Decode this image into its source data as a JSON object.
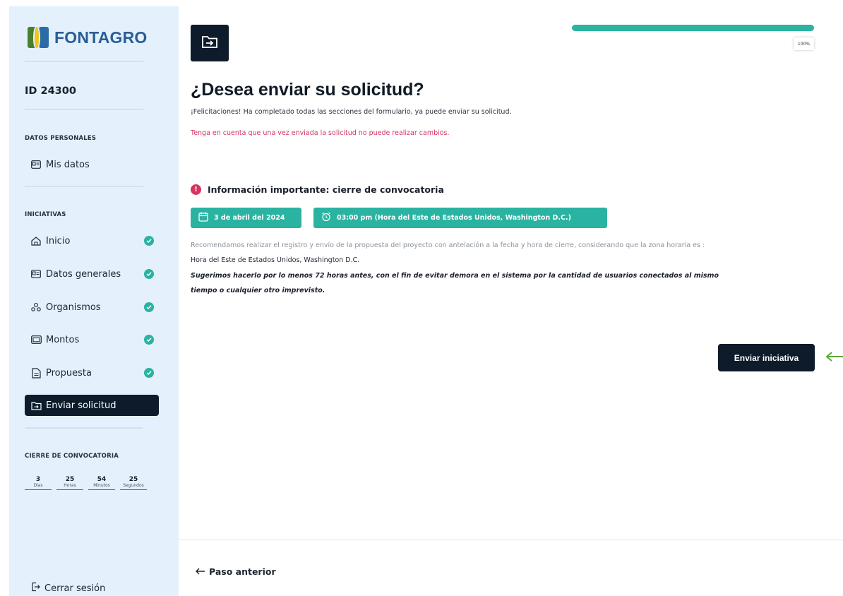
{
  "sidebar": {
    "brand": "FONTAGRO",
    "id_label": "ID 24300",
    "sections": {
      "personal": "DATOS PERSONALES",
      "initiatives": "INICIATIVAS",
      "deadline": "CIERRE DE CONVOCATORIA"
    },
    "personal_items": [
      {
        "label": "Mis datos",
        "icon": "id-card-icon"
      }
    ],
    "items": [
      {
        "label": "Inicio",
        "icon": "home-icon",
        "completed": true
      },
      {
        "label": "Datos generales",
        "icon": "id-card-icon",
        "completed": true
      },
      {
        "label": "Organismos",
        "icon": "organization-icon",
        "completed": true
      },
      {
        "label": "Montos",
        "icon": "money-icon",
        "completed": true
      },
      {
        "label": "Propuesta",
        "icon": "document-icon",
        "completed": true
      },
      {
        "label": "Enviar solicitud",
        "icon": "send-folder-icon",
        "active": true
      }
    ],
    "countdown": [
      {
        "value": "3",
        "unit": "Días"
      },
      {
        "value": "25",
        "unit": "Horas"
      },
      {
        "value": "54",
        "unit": "Minutos"
      },
      {
        "value": "25",
        "unit": "Segundos"
      }
    ],
    "logout": "Cerrar sesión"
  },
  "progress": {
    "percent": 100,
    "label": "100%"
  },
  "main": {
    "title": "¿Desea enviar su solicitud?",
    "congrats": "¡Felicitaciones! Ha completado todas las secciones del formulario, ya puede enviar su solicitud.",
    "warning": "Tenga en cuenta que una vez enviada la solicitud no puede realizar cambios.",
    "info_heading": "Información importante: cierre de convocatoria",
    "date_chip": "3 de abril del 2024",
    "time_chip": "03:00 pm (Hora del Este de Estados Unidos, Washington D.C.)",
    "recommend_line1": "Recomendamos realizar el registro y envío de la propuesta del proyecto con antelación a la fecha y hora de cierre, considerando que la zona horaria es :",
    "recommend_line2": "Hora del Este de Estados Unidos, Washington D.C.",
    "suggest_line1": "Sugerimos hacerlo por lo menos 72 horas antes, con el fin de evitar demora en el sistema por la cantidad de usuarios conectados al mismo",
    "suggest_line2": "tiempo o cualquier otro imprevisto.",
    "send_button": "Enviar iniciativa",
    "prev_step": "Paso anterior"
  },
  "colors": {
    "accent": "#2ab3a1",
    "dark": "#0d1b2a",
    "warning": "#d6335f",
    "sidebar_bg": "#e4f0fb",
    "annotation_arrow": "#5aa83a"
  }
}
